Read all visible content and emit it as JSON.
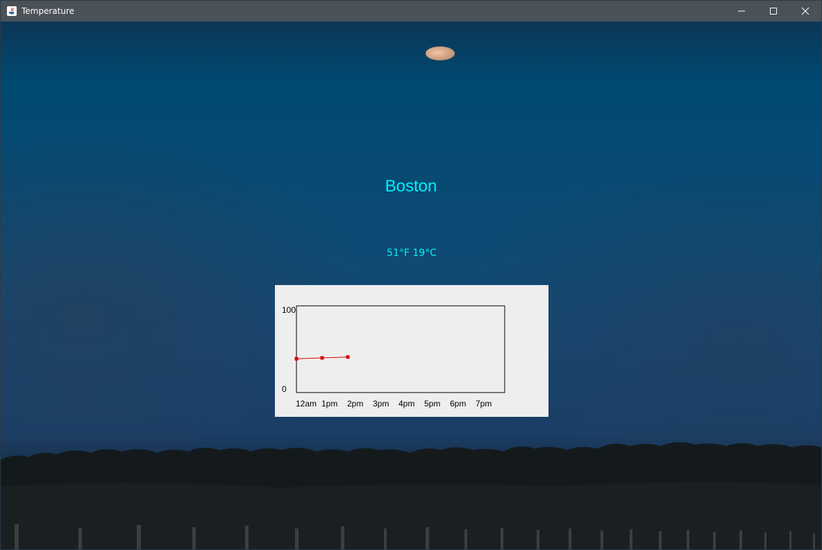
{
  "window": {
    "title": "Temperature",
    "controls": {
      "minimize_icon": "minimize-icon",
      "maximize_icon": "maximize-icon",
      "close_icon": "close-icon"
    }
  },
  "main": {
    "city": "Boston",
    "temperature_text": "51°F 19°C"
  },
  "colors": {
    "title_bar": "#4a5157",
    "accent_text": "#00f0f8",
    "chart_bg": "#eeeeee",
    "series_line": "#e00000"
  },
  "chart_data": {
    "type": "line",
    "categories": [
      "12am",
      "1pm",
      "2pm",
      "3pm",
      "4pm",
      "5pm",
      "6pm",
      "7pm"
    ],
    "series": [
      {
        "values": [
          39,
          40,
          41
        ]
      }
    ],
    "y_tick_labels": [
      "100",
      "0"
    ],
    "ylim": [
      0,
      100
    ],
    "grid": false,
    "legend": "none"
  }
}
